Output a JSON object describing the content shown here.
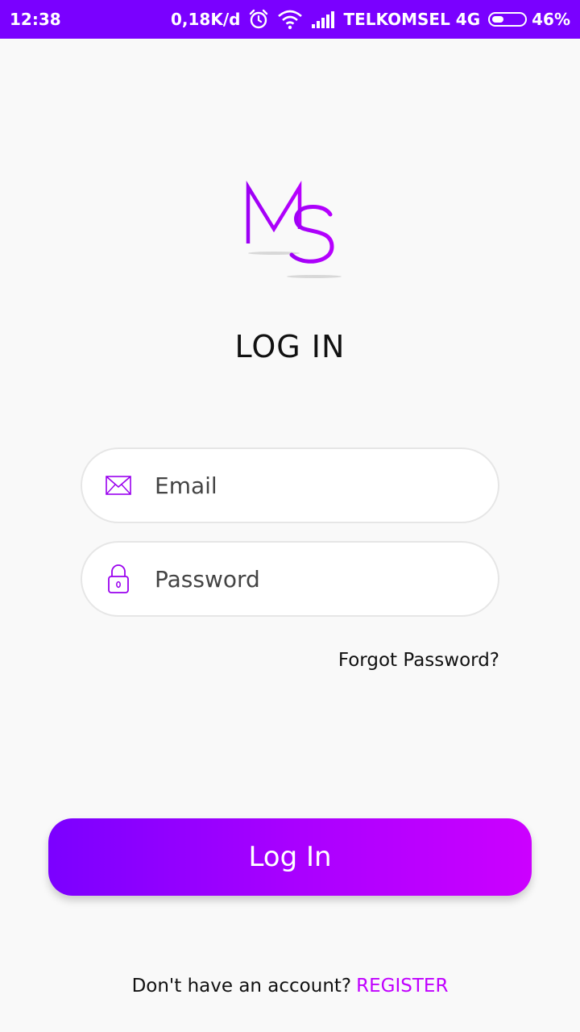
{
  "status_bar": {
    "time": "12:38",
    "network_speed": "0,18K/d",
    "carrier": "TELKOMSEL 4G",
    "battery_percent": "46%",
    "battery_level": 0.46,
    "icons": [
      "alarm-icon",
      "wifi-icon",
      "signal-icon",
      "battery-icon"
    ],
    "background": "#7a00ff"
  },
  "logo": {
    "letters": "MS",
    "color": "#a800ff"
  },
  "title": "LOG IN",
  "email": {
    "placeholder": "Email",
    "value": "",
    "icon": "mail-icon"
  },
  "password": {
    "placeholder": "Password",
    "value": "",
    "icon": "lock-icon"
  },
  "forgot_password": "Forgot Password?",
  "login_button": {
    "label": "Log In",
    "gradient_start": "#7b00ff",
    "gradient_end": "#cc00ff"
  },
  "footer": {
    "prompt": "Don't have an account?",
    "register_label": "REGISTER",
    "register_color": "#c000ff"
  }
}
